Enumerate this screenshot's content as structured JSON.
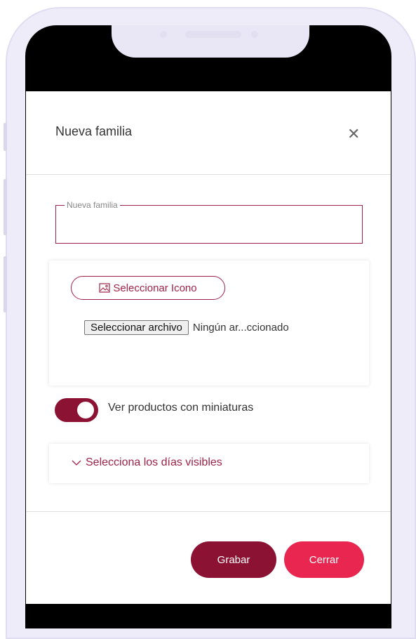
{
  "modal": {
    "title": "Nueva familia",
    "close_icon": "close-icon"
  },
  "name_field": {
    "legend": "Nueva familia",
    "value": ""
  },
  "icon_section": {
    "select_icon_label": "Seleccionar Icono",
    "image_icon": "image-icon",
    "file_button_label": "Seleccionar archivo",
    "file_status": "Ningún ar...ccionado"
  },
  "thumbnails_toggle": {
    "label": "Ver productos con miniaturas",
    "checked": true
  },
  "days_section": {
    "label": "Selecciona los días visibles",
    "chevron_icon": "chevron-down-icon"
  },
  "footer": {
    "save_label": "Grabar",
    "close_label": "Cerrar"
  },
  "colors": {
    "primary": "#8b1232",
    "accent": "#e8264f",
    "outline": "#9e2247"
  }
}
